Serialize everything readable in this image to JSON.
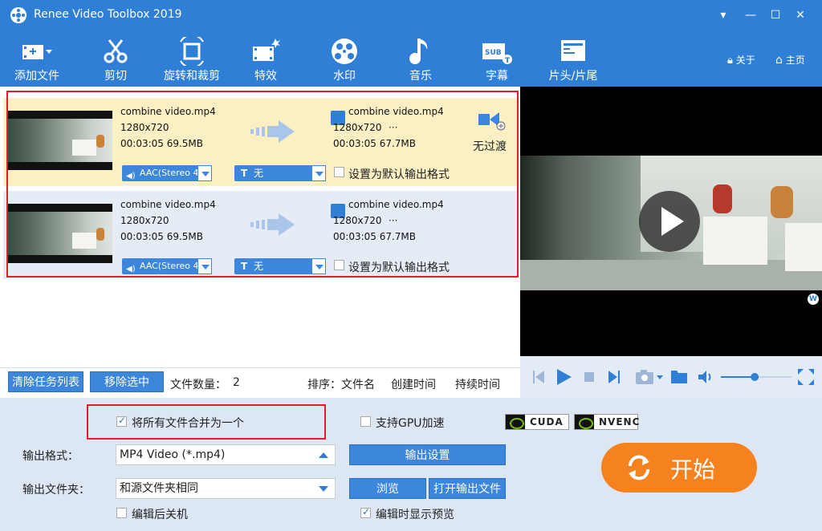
{
  "app": {
    "title": "Renee Video Toolbox 2019"
  },
  "window_controls": {
    "menu": "▾",
    "minimize": "—",
    "maximize": "☐",
    "close": "✕"
  },
  "toolbar": {
    "items": [
      {
        "label": "添加文件",
        "icon": "add-file-icon"
      },
      {
        "label": "剪切",
        "icon": "cut-icon"
      },
      {
        "label": "旋转和裁剪",
        "icon": "rotate-crop-icon"
      },
      {
        "label": "特效",
        "icon": "effects-icon"
      },
      {
        "label": "水印",
        "icon": "watermark-icon"
      },
      {
        "label": "音乐",
        "icon": "music-icon"
      },
      {
        "label": "字幕",
        "icon": "subtitle-icon"
      },
      {
        "label": "片头/片尾",
        "icon": "intro-outro-icon"
      }
    ],
    "about": "关于",
    "home": "主页"
  },
  "files": [
    {
      "src_name": "combine video.mp4",
      "src_res": "1280x720",
      "src_info": "00:03:05  69.5MB",
      "out_name": "combine video.mp4",
      "out_res": "1280x720",
      "out_dots": "···",
      "out_info": "00:03:05  67.7MB",
      "audio": "AAC(Stereo 4",
      "subtitle_icon": "T",
      "subtitle": "无",
      "default_format": "设置为默认输出格式",
      "default_checked": false,
      "transition": "无过渡"
    },
    {
      "src_name": "combine video.mp4",
      "src_res": "1280x720",
      "src_info": "00:03:05  69.5MB",
      "out_name": "combine video.mp4",
      "out_res": "1280x720",
      "out_dots": "···",
      "out_info": "00:03:05  67.7MB",
      "audio": "AAC(Stereo 4",
      "subtitle_icon": "T",
      "subtitle": "无",
      "default_format": "设置为默认输出格式",
      "default_checked": false
    }
  ],
  "tasks": {
    "clear_label": "清除任务列表",
    "remove_label": "移除选中",
    "count_label": "文件数量：",
    "count_value": "2",
    "sort_label": "排序：文件名",
    "sort_created": "创建时间",
    "sort_duration": "持续时间"
  },
  "player": {
    "volume_fraction": 0.48,
    "watermark_logo": "W"
  },
  "options": {
    "merge_label": "将所有文件合并为一个",
    "merge_checked": true,
    "gpu_label": "支持GPU加速",
    "gpu_checked": false,
    "cuda": "CUDA",
    "nvenc": "NVENC",
    "format_label": "输出格式：",
    "format_value": "MP4 Video (*.mp4)",
    "output_settings": "输出设置",
    "folder_label": "输出文件夹：",
    "folder_value": "和源文件夹相同",
    "browse": "浏览",
    "open_folder": "打开输出文件",
    "shutdown_label": "编辑后关机",
    "shutdown_checked": false,
    "preview_label": "编辑时显示预览",
    "preview_checked": true,
    "start": "开始"
  },
  "colors": {
    "accent": "#2f7fd6",
    "start": "#f5821f",
    "highlight": "#e8192c",
    "row_selected": "#fbf0c3",
    "row": "#e6ecf5"
  }
}
